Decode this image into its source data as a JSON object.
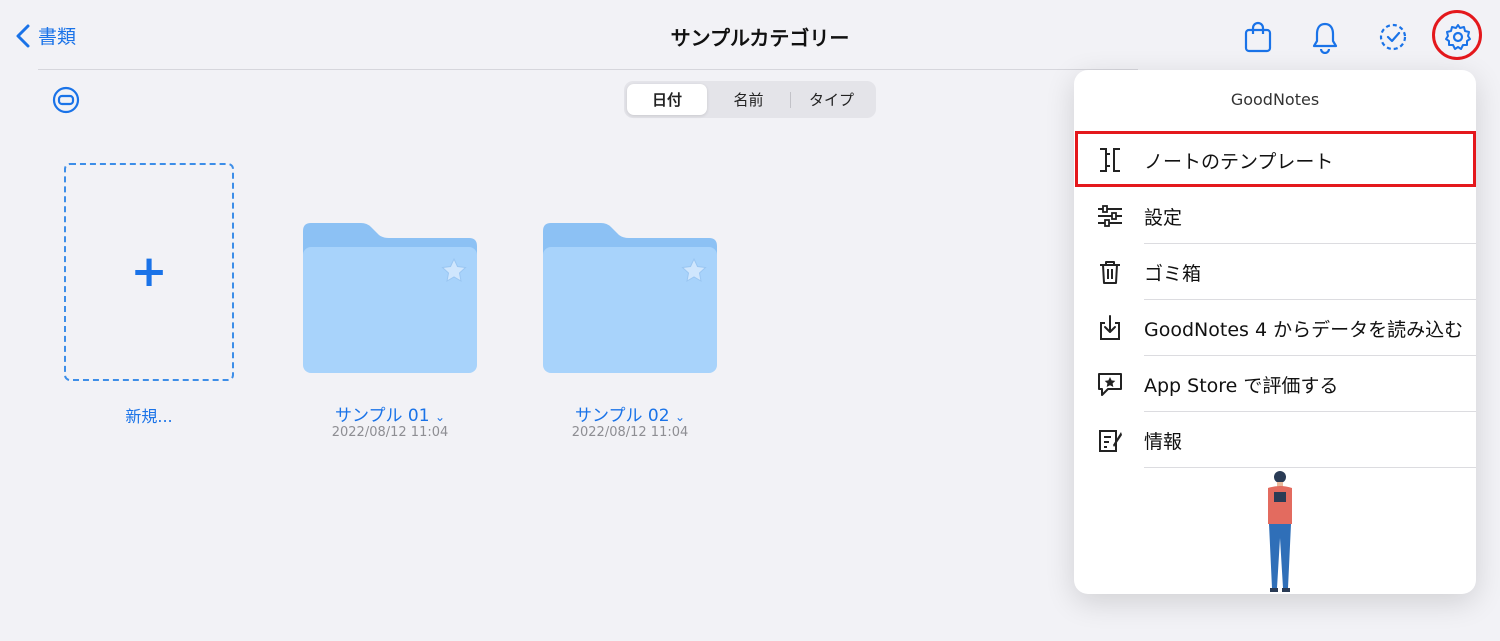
{
  "nav": {
    "back_label": "書類",
    "title": "サンプルカテゴリー"
  },
  "sort": {
    "options": [
      "日付",
      "名前",
      "タイプ"
    ],
    "selected": "日付"
  },
  "new_item": {
    "plus": "+",
    "label": "新規..."
  },
  "folders": [
    {
      "name": "サンプル 01",
      "date": "2022/08/12 11:04"
    },
    {
      "name": "サンプル 02",
      "date": "2022/08/12 11:04"
    }
  ],
  "menu": {
    "title": "GoodNotes",
    "items": [
      {
        "label": "ノートのテンプレート",
        "icon": "template-icon"
      },
      {
        "label": "設定",
        "icon": "sliders-icon"
      },
      {
        "label": "ゴミ箱",
        "icon": "trash-icon"
      },
      {
        "label": "GoodNotes 4 からデータを読み込む",
        "icon": "import-icon"
      },
      {
        "label": "App Store で評価する",
        "icon": "rate-icon"
      },
      {
        "label": "情報",
        "icon": "info-icon"
      }
    ]
  },
  "colors": {
    "accent": "#1a73e8",
    "highlight": "#e4181c",
    "folder": "#a8d3fb",
    "folder_tab": "#8cc1f4"
  }
}
